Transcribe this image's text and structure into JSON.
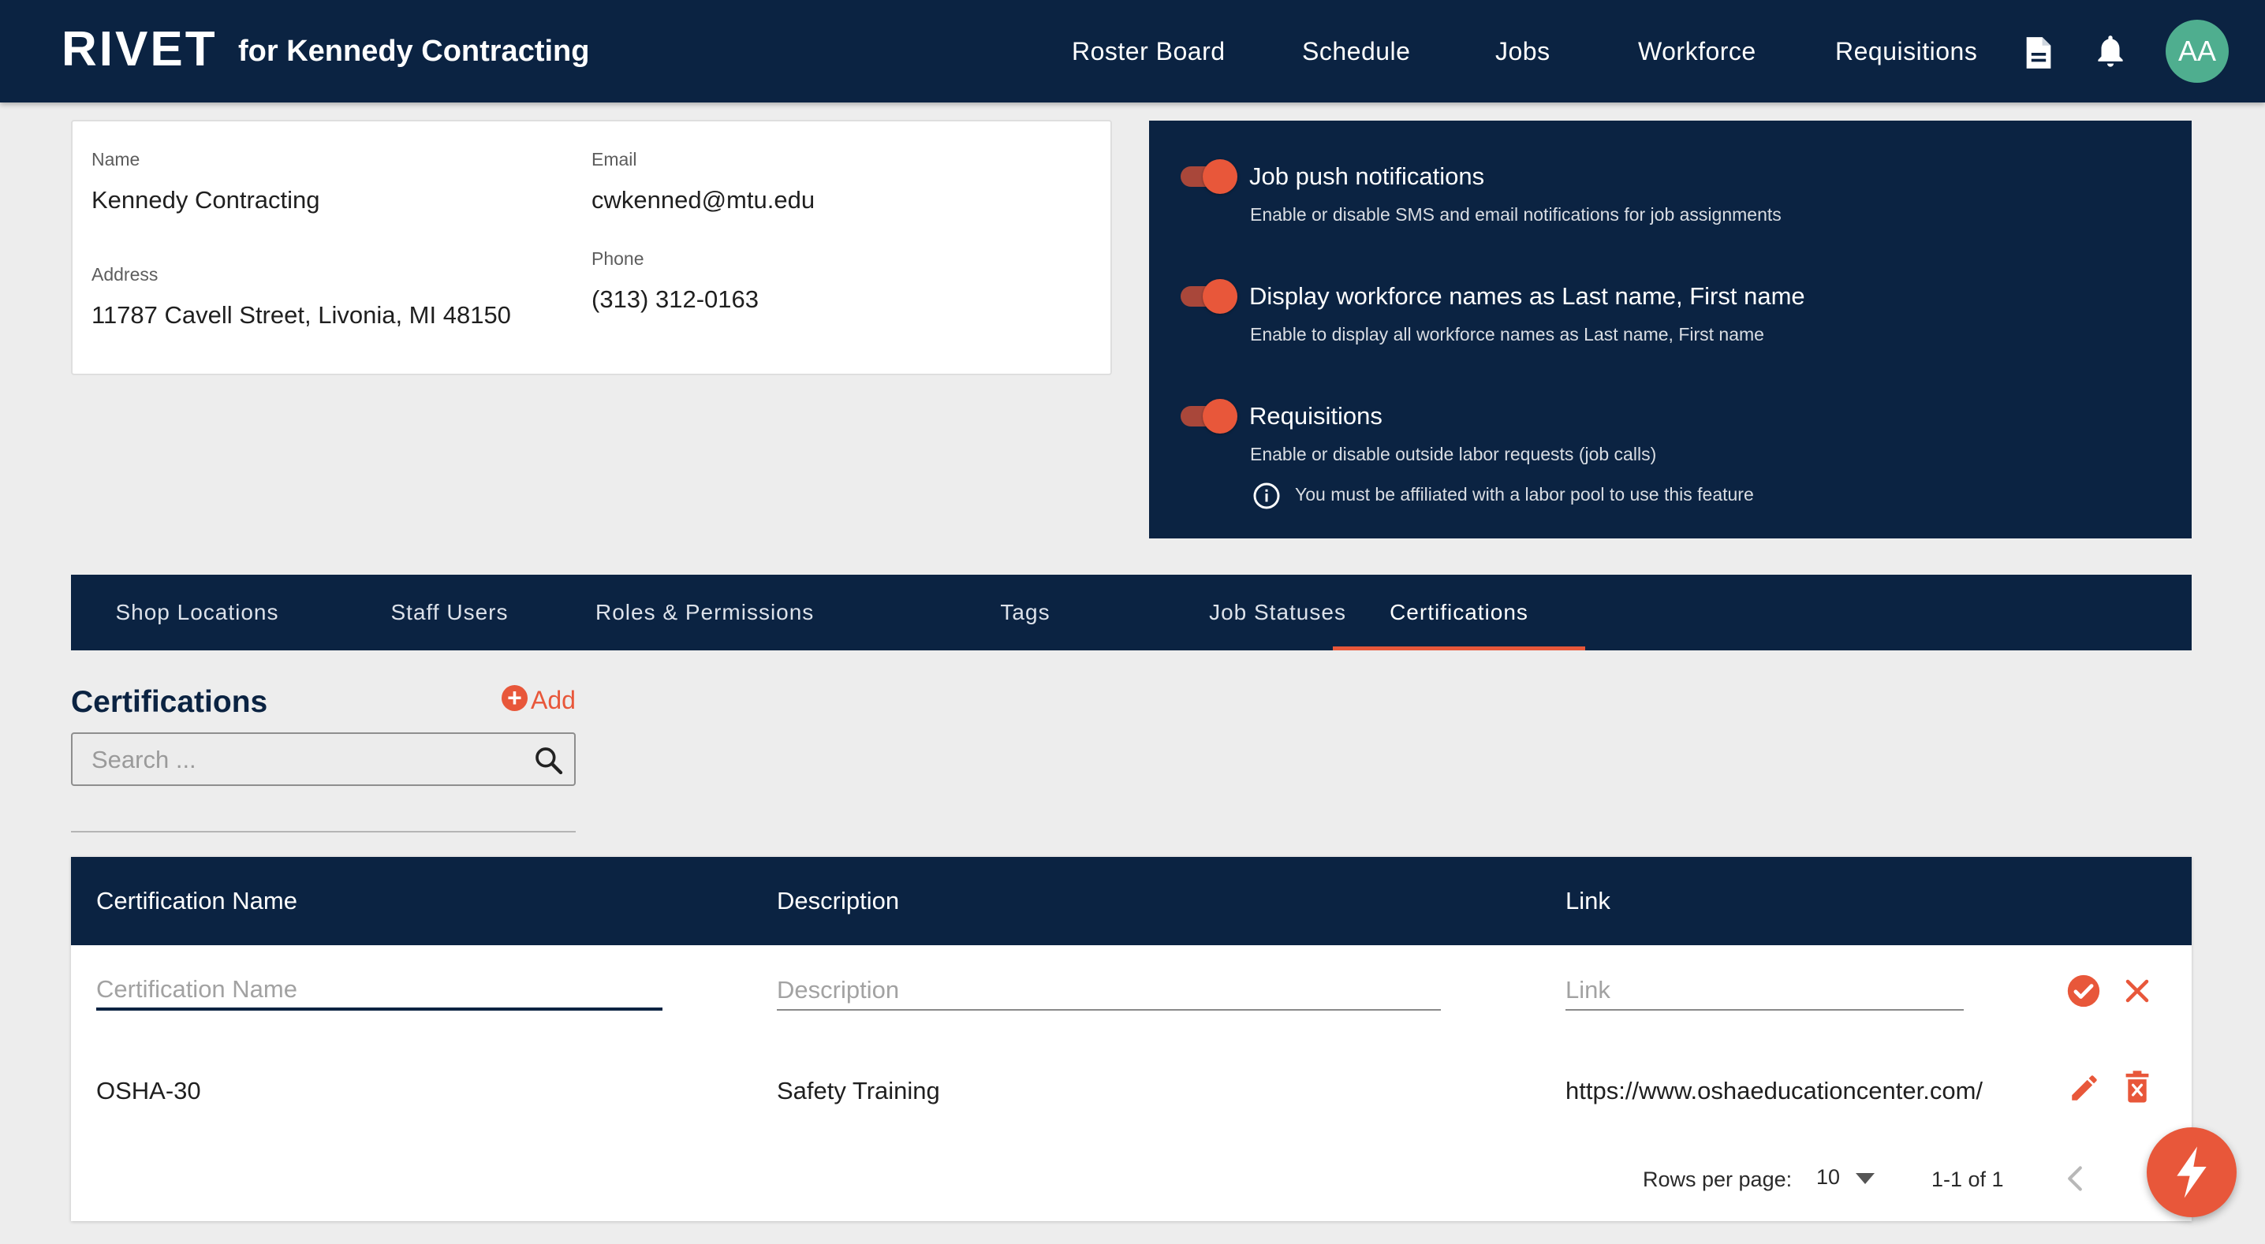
{
  "app": {
    "logo": "RIVET",
    "subtitle": "for Kennedy Contracting"
  },
  "nav": {
    "items": [
      "Roster Board",
      "Schedule",
      "Jobs",
      "Workforce",
      "Requisitions"
    ],
    "avatar_initials": "AA",
    "icons": [
      "document-icon",
      "bell-icon"
    ]
  },
  "company": {
    "name_label": "Name",
    "name_value": "Kennedy Contracting",
    "email_label": "Email",
    "email_value": "cwkenned@mtu.edu",
    "address_label": "Address",
    "address_value": "11787 Cavell Street, Livonia, MI 48150",
    "phone_label": "Phone",
    "phone_value": "(313) 312-0163"
  },
  "settings": {
    "items": [
      {
        "title": "Job push notifications",
        "description": "Enable or disable SMS and email notifications for job assignments",
        "enabled": true
      },
      {
        "title": "Display workforce names as Last name, First name",
        "description": "Enable to display all workforce names as Last name, First name",
        "enabled": true
      },
      {
        "title": "Requisitions",
        "description": "Enable or disable outside labor requests (job calls)",
        "enabled": true
      }
    ],
    "requisitions_note": "You must be affiliated with a labor pool to use this feature"
  },
  "tabs": {
    "items": [
      "Shop Locations",
      "Staff Users",
      "Roles & Permissions",
      "Tags",
      "Job Statuses",
      "Certifications"
    ],
    "active": "Certifications"
  },
  "certifications": {
    "title": "Certifications",
    "add_label": "Add",
    "search_placeholder": "Search ...",
    "columns": [
      "Certification Name",
      "Description",
      "Link"
    ],
    "new_row": {
      "name_placeholder": "Certification Name",
      "description_placeholder": "Description",
      "link_placeholder": "Link"
    },
    "rows": [
      {
        "name": "OSHA-30",
        "description": "Safety Training",
        "link": "https://www.oshaeducationcenter.com/"
      }
    ],
    "pagination": {
      "rows_per_page_label": "Rows per page:",
      "rows_per_page": "10",
      "range": "1-1 of 1"
    }
  },
  "colors": {
    "navy": "#0b2342",
    "accent": "#e8573a",
    "avatar": "#4fae8f"
  }
}
